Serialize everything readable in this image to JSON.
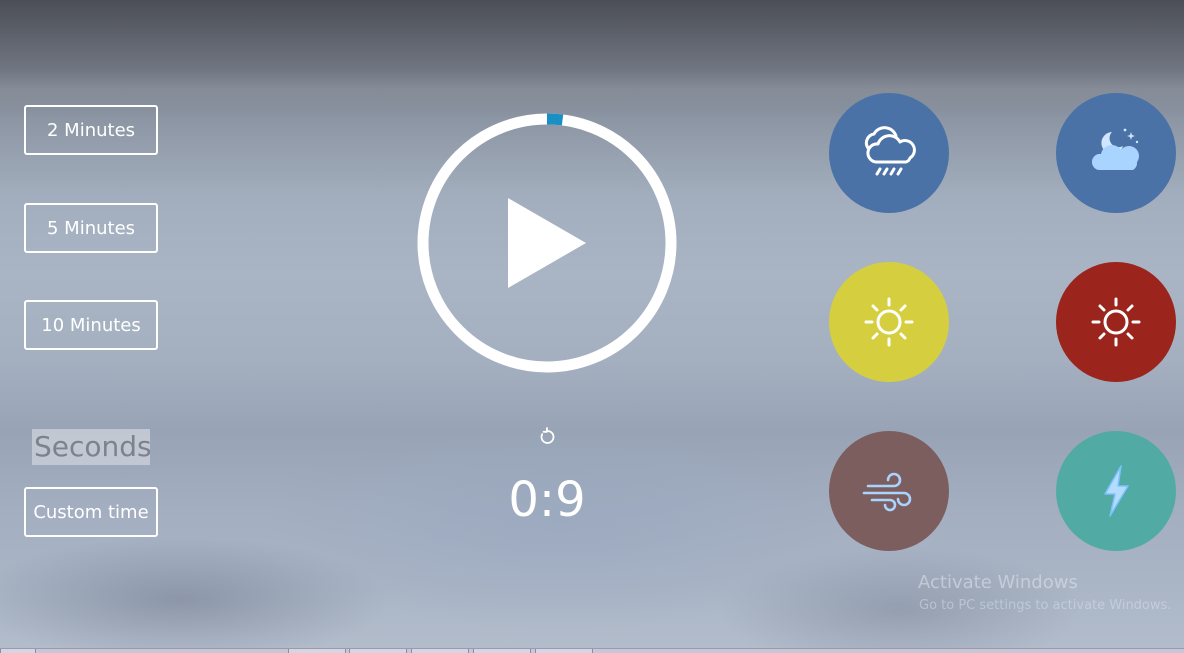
{
  "presets": {
    "two_min": "2 Minutes",
    "five_min": "5 Minutes",
    "ten_min": "10 Minutes"
  },
  "custom": {
    "seconds_value": "Seconds",
    "button_label": "Custom time"
  },
  "timer": {
    "display": "0:9",
    "progress": 0.02,
    "ring_color": "#ffffff",
    "progress_color": "#1a8fc4"
  },
  "sounds": [
    {
      "icon": "rain-cloud-icon",
      "color": "#4a72a6"
    },
    {
      "icon": "night-cloud-icon",
      "color": "#4a72a6"
    },
    {
      "icon": "sun-icon",
      "color": "#d5cf3f"
    },
    {
      "icon": "sun-icon",
      "color": "#9b241d"
    },
    {
      "icon": "wind-icon",
      "color": "#7d5e5e"
    },
    {
      "icon": "lightning-icon",
      "color": "#52aaa5"
    }
  ],
  "watermark": {
    "title": "Activate Windows",
    "subtitle": "Go to PC settings to activate Windows."
  }
}
